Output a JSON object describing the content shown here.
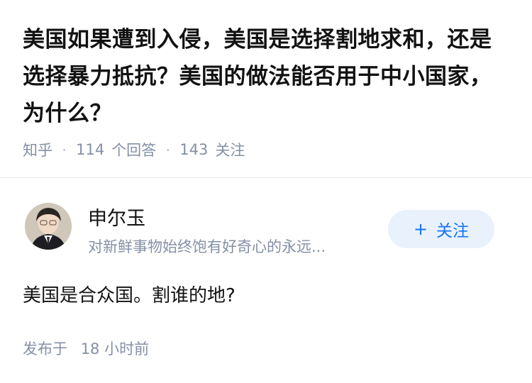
{
  "question": {
    "title": "美国如果遭到入侵，美国是选择割地求和，还是选择暴力抵抗？美国的做法能否用于中小国家，为什么？",
    "source": "知乎",
    "answer_count": "114",
    "answer_label": "个回答",
    "follower_count": "143",
    "follower_label": "关注",
    "separator": "·"
  },
  "author": {
    "name": "申尔玉",
    "bio": "对新鲜事物始终饱有好奇心的永远...",
    "avatar_icon": "avatar-photo",
    "follow": {
      "plus": "+",
      "label": "关注"
    }
  },
  "answer": {
    "content": "美国是合众国。割谁的地?",
    "published_label": "发布于",
    "published_time": "18 小时前"
  },
  "colors": {
    "accent": "#1772f6",
    "follow_bg": "#e8f1fc",
    "meta_gray": "#8590a6"
  }
}
